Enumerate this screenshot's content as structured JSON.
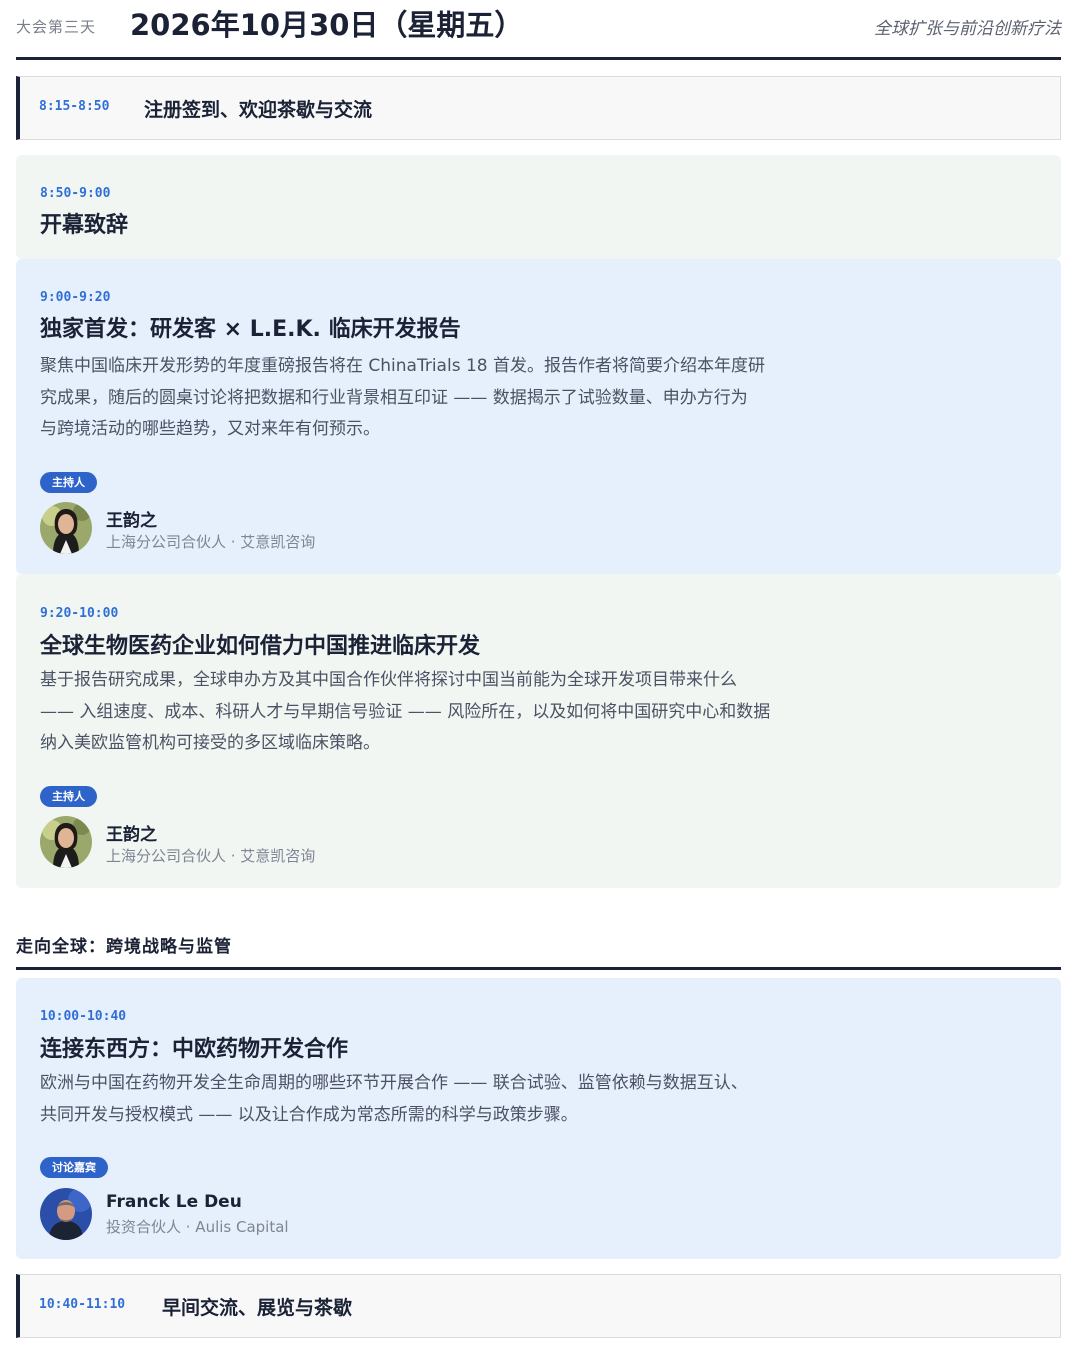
{
  "header": {
    "day_label": "大会第三天",
    "date_title": "2026年10月30日（星期五）",
    "theme": "全球扩张与前沿创新疗法"
  },
  "breaks": [
    {
      "time": "8:15-8:50",
      "label": "注册签到、欢迎茶歇与交流"
    },
    {
      "time": "10:40-11:10",
      "label": "早间交流、展览与茶歇"
    }
  ],
  "sessions": [
    {
      "time": "8:50-9:00",
      "title": "开幕致辞"
    },
    {
      "time": "9:00-9:20",
      "title": "独家首发：研发客 × L.E.K. 临床开发报告",
      "desc_lines": [
        "聚焦中国临床开发形势的年度重磅报告将在 ChinaTrials 18 首发。报告作者将简要介绍本年度研",
        "究成果，随后的圆桌讨论将把数据和行业背景相互印证 —— 数据揭示了试验数量、申办方行为",
        "与跨境活动的哪些趋势，又对来年有何预示。"
      ],
      "role_badge": "主持人",
      "speaker_name": "王韵之",
      "speaker_role": "上海分公司合伙人 · 艾意凯咨询"
    },
    {
      "time": "9:20-10:00",
      "title": "全球生物医药企业如何借力中国推进临床开发",
      "desc_lines": [
        "基于报告研究成果，全球申办方及其中国合作伙伴将探讨中国当前能为全球开发项目带来什么",
        "—— 入组速度、成本、科研人才与早期信号验证 —— 风险所在，以及如何将中国研究中心和数据",
        "纳入美欧监管机构可接受的多区域临床策略。"
      ],
      "role_badge": "主持人",
      "speaker_name": "王韵之",
      "speaker_role": "上海分公司合伙人 · 艾意凯咨询"
    },
    {
      "time": "10:00-10:40",
      "title": "连接东西方：中欧药物开发合作",
      "desc_lines": [
        "欧洲与中国在药物开发全生命周期的哪些环节开展合作 —— 联合试验、监管依赖与数据互认、",
        "共同开发与授权模式 —— 以及让合作成为常态所需的科学与政策步骤。"
      ],
      "role_badge": "讨论嘉宾",
      "speaker_name": "Franck Le Deu",
      "speaker_role": "投资合伙人 · Aulis Capital"
    }
  ],
  "section": {
    "title": "走向全球：跨境战略与监管"
  },
  "colors": {
    "accent_blue": "#2f6fd6",
    "badge_blue": "#2e63c9",
    "navy_rule": "#1b2338",
    "card_green": "#f1f6f3",
    "card_blue": "#e6effc"
  },
  "icons": [
    "avatar-photo-wang",
    "avatar-photo-franck"
  ]
}
